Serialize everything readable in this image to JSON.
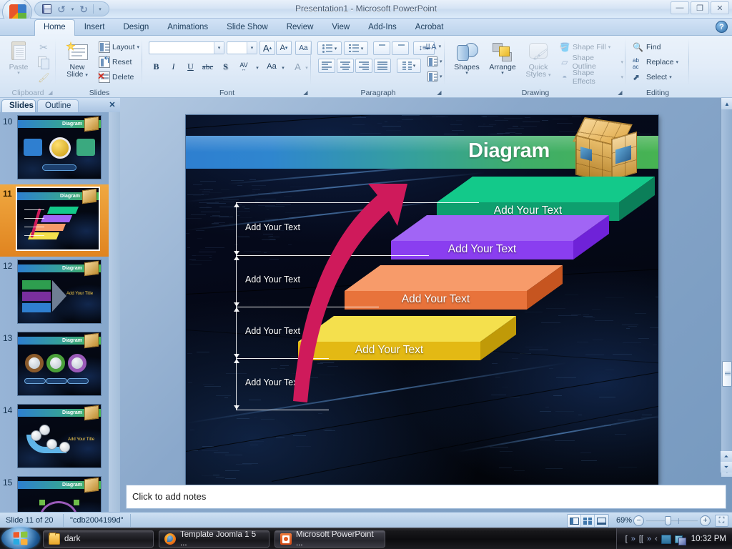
{
  "window": {
    "title": "Presentation1 - Microsoft PowerPoint",
    "minimize": "—",
    "maximize": "❐",
    "close": "✕"
  },
  "quick_access": {
    "office_button": "office-button",
    "save": "Save",
    "undo": "Undo",
    "undo_caret": "▾",
    "redo": "Redo",
    "customize": "▾"
  },
  "ribbon": {
    "tabs": [
      {
        "label": "Home",
        "active": true
      },
      {
        "label": "Insert",
        "active": false
      },
      {
        "label": "Design",
        "active": false
      },
      {
        "label": "Animations",
        "active": false
      },
      {
        "label": "Slide Show",
        "active": false
      },
      {
        "label": "Review",
        "active": false
      },
      {
        "label": "View",
        "active": false
      },
      {
        "label": "Add-Ins",
        "active": false
      },
      {
        "label": "Acrobat",
        "active": false
      }
    ],
    "help_label": "?",
    "groups": {
      "clipboard": {
        "label": "Clipboard",
        "paste": "Paste",
        "paste_caret": "▾",
        "cut": "Cut",
        "copy": "Copy",
        "format_painter": "Format Painter",
        "launcher": "◢"
      },
      "slides": {
        "label": "Slides",
        "new_slide": "New\nSlide",
        "new_slide_line1": "New",
        "new_slide_line2": "Slide",
        "new_slide_caret": "▾",
        "layout": "Layout",
        "layout_caret": "▾",
        "reset": "Reset",
        "delete": "Delete"
      },
      "font": {
        "label": "Font",
        "font_name_value": "",
        "font_size_value": "",
        "grow_font": "A",
        "shrink_font": "A",
        "clear_formatting": "Aa",
        "bold": "B",
        "italic": "I",
        "underline": "U",
        "strikethrough": "abc",
        "shadow": "S",
        "spacing": "AV",
        "change_case": "Aa",
        "font_color": "A",
        "launcher": "◢"
      },
      "paragraph": {
        "label": "Paragraph",
        "bullets": "Bullets",
        "numbering": "Numbering",
        "decrease_indent": "Decrease List Level",
        "increase_indent": "Increase List Level",
        "line_spacing": "Line Spacing",
        "text_direction": "Text Direction",
        "align_text": "Align Text",
        "convert_smartart": "Convert to SmartArt",
        "align_left": "Align Left",
        "center": "Center",
        "align_right": "Align Right",
        "justify": "Justify",
        "columns": "Columns",
        "launcher": "◢"
      },
      "drawing": {
        "label": "Drawing",
        "shapes": "Shapes",
        "shapes_caret": "▾",
        "arrange": "Arrange",
        "arrange_caret": "▾",
        "quick_styles_line1": "Quick",
        "quick_styles_line2": "Styles",
        "quick_styles_caret": "▾",
        "shape_fill": "Shape Fill",
        "shape_outline": "Shape Outline",
        "shape_effects": "Shape Effects",
        "caret": "▾",
        "launcher": "◢"
      },
      "editing": {
        "label": "Editing",
        "find": "Find",
        "replace": "Replace",
        "replace_caret": "▾",
        "select": "Select",
        "select_caret": "▾"
      }
    }
  },
  "left_pane": {
    "tabs": [
      {
        "label": "Slides",
        "active": true
      },
      {
        "label": "Outline",
        "active": false
      }
    ],
    "close": "✕",
    "scroll_up": "▲",
    "scroll_down": "▼",
    "thumbnails": [
      {
        "number": "10",
        "selected": false,
        "title": "Diagram",
        "kind": "concept-wheel"
      },
      {
        "number": "11",
        "selected": true,
        "title": "Diagram",
        "kind": "stairstep"
      },
      {
        "number": "12",
        "selected": false,
        "title": "Diagram",
        "kind": "arrow-stack"
      },
      {
        "number": "13",
        "selected": false,
        "title": "Diagram",
        "kind": "three-rings"
      },
      {
        "number": "14",
        "selected": false,
        "title": "Diagram",
        "kind": "curved-arrow"
      },
      {
        "number": "15",
        "selected": false,
        "title": "Diagram",
        "kind": "cycle"
      }
    ]
  },
  "slide": {
    "title": "Diagram",
    "band_colors": {
      "left": "#2e7fd0",
      "mid": "#35a09c",
      "right": "#47b352"
    },
    "steps": [
      {
        "label": "Add Your Text",
        "top_color": "#13c98a",
        "front_color": "#0e9f6e",
        "side_color": "#0b7f59"
      },
      {
        "label": "Add Your Text",
        "top_color": "#a165f5",
        "front_color": "#8a3ef0",
        "side_color": "#6f22d8"
      },
      {
        "label": "Add Your Text",
        "top_color": "#f79b6a",
        "front_color": "#e8733b",
        "side_color": "#c65520"
      },
      {
        "label": "Add Your Text",
        "top_color": "#f4e04d",
        "front_color": "#e3b914",
        "side_color": "#c09a08"
      }
    ],
    "measures": [
      {
        "label": "Add Your Text"
      },
      {
        "label": "Add Your Text"
      },
      {
        "label": "Add Your Text"
      },
      {
        "label": "Add Your Text"
      }
    ],
    "arrow_color": "#cf1a5b"
  },
  "notes": {
    "placeholder": "Click to add notes"
  },
  "status_bar": {
    "slide_counter": "Slide 11 of 20",
    "theme_name": "\"cdb2004199d\"",
    "view_normal": "Normal View",
    "view_sorter": "Slide Sorter",
    "view_show": "Slide Show",
    "zoom_level": "69%",
    "zoom_out": "−",
    "zoom_in": "+",
    "fit_to_window": "Fit slide to current window"
  },
  "taskbar": {
    "start": "Start",
    "buttons": [
      {
        "label": "dark",
        "icon": "folder-icon"
      },
      {
        "label": "Template Joomla 1 5 ...",
        "icon": "firefox-icon"
      },
      {
        "label": "Microsoft PowerPoint ...",
        "icon": "powerpoint-icon",
        "active": true
      }
    ],
    "tray": {
      "expand1": "»",
      "expand2": "»",
      "bracket1": "[",
      "bracket2": "[[",
      "arrow": "‹",
      "clock": "10:32 PM"
    }
  }
}
